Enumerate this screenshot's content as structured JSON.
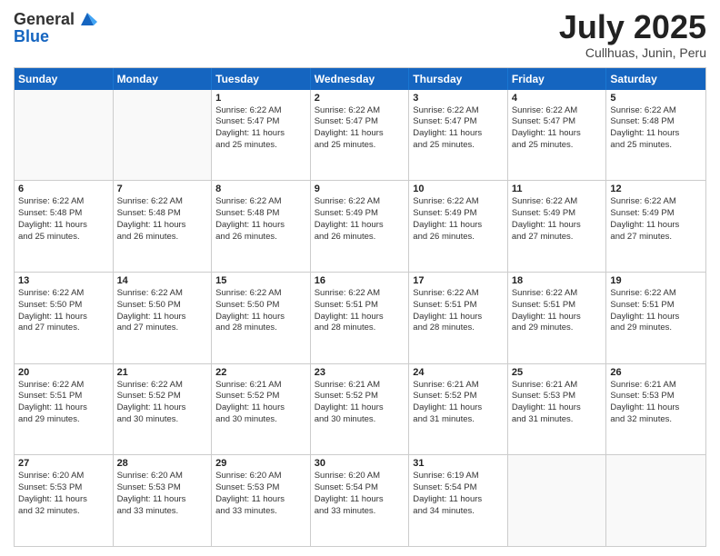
{
  "logo": {
    "general": "General",
    "blue": "Blue"
  },
  "header": {
    "month": "July 2025",
    "location": "Cullhuas, Junin, Peru"
  },
  "weekdays": [
    "Sunday",
    "Monday",
    "Tuesday",
    "Wednesday",
    "Thursday",
    "Friday",
    "Saturday"
  ],
  "weeks": [
    [
      {
        "day": "",
        "empty": true
      },
      {
        "day": "",
        "empty": true
      },
      {
        "day": "1",
        "l1": "Sunrise: 6:22 AM",
        "l2": "Sunset: 5:47 PM",
        "l3": "Daylight: 11 hours",
        "l4": "and 25 minutes."
      },
      {
        "day": "2",
        "l1": "Sunrise: 6:22 AM",
        "l2": "Sunset: 5:47 PM",
        "l3": "Daylight: 11 hours",
        "l4": "and 25 minutes."
      },
      {
        "day": "3",
        "l1": "Sunrise: 6:22 AM",
        "l2": "Sunset: 5:47 PM",
        "l3": "Daylight: 11 hours",
        "l4": "and 25 minutes."
      },
      {
        "day": "4",
        "l1": "Sunrise: 6:22 AM",
        "l2": "Sunset: 5:47 PM",
        "l3": "Daylight: 11 hours",
        "l4": "and 25 minutes."
      },
      {
        "day": "5",
        "l1": "Sunrise: 6:22 AM",
        "l2": "Sunset: 5:48 PM",
        "l3": "Daylight: 11 hours",
        "l4": "and 25 minutes."
      }
    ],
    [
      {
        "day": "6",
        "l1": "Sunrise: 6:22 AM",
        "l2": "Sunset: 5:48 PM",
        "l3": "Daylight: 11 hours",
        "l4": "and 25 minutes."
      },
      {
        "day": "7",
        "l1": "Sunrise: 6:22 AM",
        "l2": "Sunset: 5:48 PM",
        "l3": "Daylight: 11 hours",
        "l4": "and 26 minutes."
      },
      {
        "day": "8",
        "l1": "Sunrise: 6:22 AM",
        "l2": "Sunset: 5:48 PM",
        "l3": "Daylight: 11 hours",
        "l4": "and 26 minutes."
      },
      {
        "day": "9",
        "l1": "Sunrise: 6:22 AM",
        "l2": "Sunset: 5:49 PM",
        "l3": "Daylight: 11 hours",
        "l4": "and 26 minutes."
      },
      {
        "day": "10",
        "l1": "Sunrise: 6:22 AM",
        "l2": "Sunset: 5:49 PM",
        "l3": "Daylight: 11 hours",
        "l4": "and 26 minutes."
      },
      {
        "day": "11",
        "l1": "Sunrise: 6:22 AM",
        "l2": "Sunset: 5:49 PM",
        "l3": "Daylight: 11 hours",
        "l4": "and 27 minutes."
      },
      {
        "day": "12",
        "l1": "Sunrise: 6:22 AM",
        "l2": "Sunset: 5:49 PM",
        "l3": "Daylight: 11 hours",
        "l4": "and 27 minutes."
      }
    ],
    [
      {
        "day": "13",
        "l1": "Sunrise: 6:22 AM",
        "l2": "Sunset: 5:50 PM",
        "l3": "Daylight: 11 hours",
        "l4": "and 27 minutes."
      },
      {
        "day": "14",
        "l1": "Sunrise: 6:22 AM",
        "l2": "Sunset: 5:50 PM",
        "l3": "Daylight: 11 hours",
        "l4": "and 27 minutes."
      },
      {
        "day": "15",
        "l1": "Sunrise: 6:22 AM",
        "l2": "Sunset: 5:50 PM",
        "l3": "Daylight: 11 hours",
        "l4": "and 28 minutes."
      },
      {
        "day": "16",
        "l1": "Sunrise: 6:22 AM",
        "l2": "Sunset: 5:51 PM",
        "l3": "Daylight: 11 hours",
        "l4": "and 28 minutes."
      },
      {
        "day": "17",
        "l1": "Sunrise: 6:22 AM",
        "l2": "Sunset: 5:51 PM",
        "l3": "Daylight: 11 hours",
        "l4": "and 28 minutes."
      },
      {
        "day": "18",
        "l1": "Sunrise: 6:22 AM",
        "l2": "Sunset: 5:51 PM",
        "l3": "Daylight: 11 hours",
        "l4": "and 29 minutes."
      },
      {
        "day": "19",
        "l1": "Sunrise: 6:22 AM",
        "l2": "Sunset: 5:51 PM",
        "l3": "Daylight: 11 hours",
        "l4": "and 29 minutes."
      }
    ],
    [
      {
        "day": "20",
        "l1": "Sunrise: 6:22 AM",
        "l2": "Sunset: 5:51 PM",
        "l3": "Daylight: 11 hours",
        "l4": "and 29 minutes."
      },
      {
        "day": "21",
        "l1": "Sunrise: 6:22 AM",
        "l2": "Sunset: 5:52 PM",
        "l3": "Daylight: 11 hours",
        "l4": "and 30 minutes."
      },
      {
        "day": "22",
        "l1": "Sunrise: 6:21 AM",
        "l2": "Sunset: 5:52 PM",
        "l3": "Daylight: 11 hours",
        "l4": "and 30 minutes."
      },
      {
        "day": "23",
        "l1": "Sunrise: 6:21 AM",
        "l2": "Sunset: 5:52 PM",
        "l3": "Daylight: 11 hours",
        "l4": "and 30 minutes."
      },
      {
        "day": "24",
        "l1": "Sunrise: 6:21 AM",
        "l2": "Sunset: 5:52 PM",
        "l3": "Daylight: 11 hours",
        "l4": "and 31 minutes."
      },
      {
        "day": "25",
        "l1": "Sunrise: 6:21 AM",
        "l2": "Sunset: 5:53 PM",
        "l3": "Daylight: 11 hours",
        "l4": "and 31 minutes."
      },
      {
        "day": "26",
        "l1": "Sunrise: 6:21 AM",
        "l2": "Sunset: 5:53 PM",
        "l3": "Daylight: 11 hours",
        "l4": "and 32 minutes."
      }
    ],
    [
      {
        "day": "27",
        "l1": "Sunrise: 6:20 AM",
        "l2": "Sunset: 5:53 PM",
        "l3": "Daylight: 11 hours",
        "l4": "and 32 minutes."
      },
      {
        "day": "28",
        "l1": "Sunrise: 6:20 AM",
        "l2": "Sunset: 5:53 PM",
        "l3": "Daylight: 11 hours",
        "l4": "and 33 minutes."
      },
      {
        "day": "29",
        "l1": "Sunrise: 6:20 AM",
        "l2": "Sunset: 5:53 PM",
        "l3": "Daylight: 11 hours",
        "l4": "and 33 minutes."
      },
      {
        "day": "30",
        "l1": "Sunrise: 6:20 AM",
        "l2": "Sunset: 5:54 PM",
        "l3": "Daylight: 11 hours",
        "l4": "and 33 minutes."
      },
      {
        "day": "31",
        "l1": "Sunrise: 6:19 AM",
        "l2": "Sunset: 5:54 PM",
        "l3": "Daylight: 11 hours",
        "l4": "and 34 minutes."
      },
      {
        "day": "",
        "empty": true
      },
      {
        "day": "",
        "empty": true
      }
    ]
  ]
}
